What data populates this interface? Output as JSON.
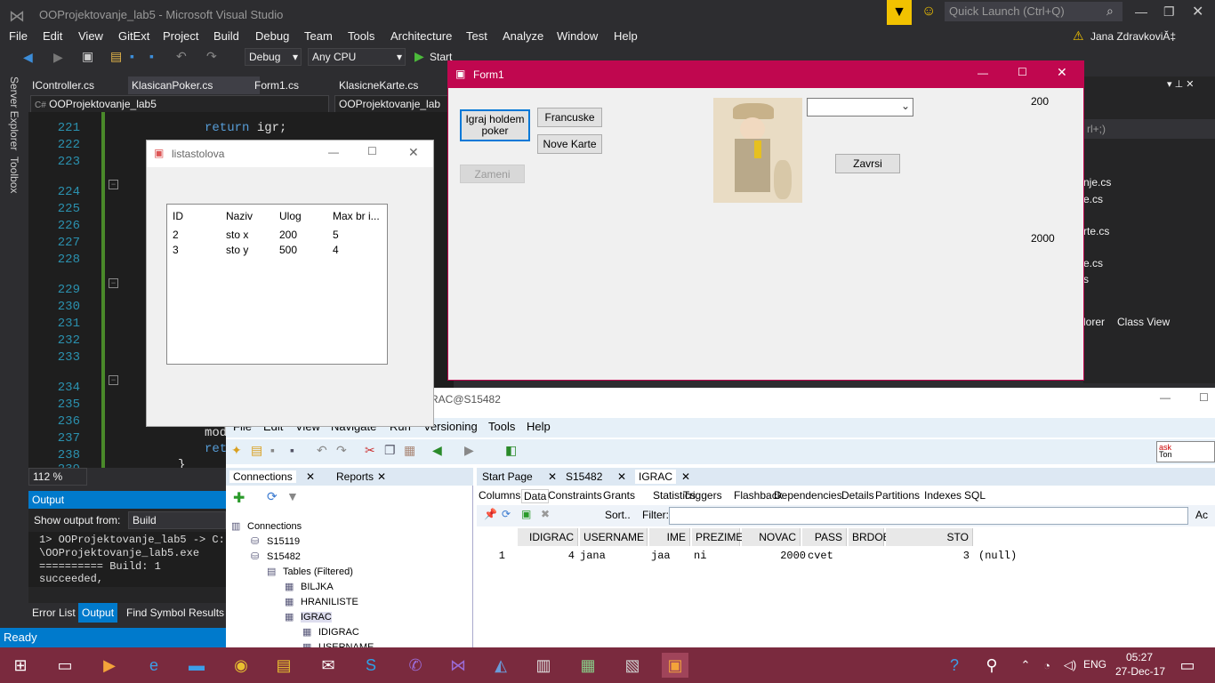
{
  "vs": {
    "title": "OOProjektovanje_lab5 - Microsoft Visual Studio",
    "quick_launch": "Quick Launch (Ctrl+Q)",
    "user": "Jana ZdravkoviĂ‡",
    "menu": [
      "File",
      "Edit",
      "View",
      "GitExt",
      "Project",
      "Build",
      "Debug",
      "Team",
      "Tools",
      "Architecture",
      "Test",
      "Analyze",
      "Window",
      "Help"
    ],
    "config": "Debug",
    "platform": "Any CPU",
    "start": "Start",
    "sidebar": [
      "Server Explorer",
      "Toolbox"
    ],
    "tabs": [
      "IController.cs",
      "KlasicanPoker.cs",
      "Form1.cs",
      "KlasicneKarte.cs"
    ],
    "project_dd": "OOProjektovanje_lab5",
    "member_dd": "OOProjektovanje_lab",
    "line_numbers": [
      "221",
      "222",
      "223",
      "224",
      "225",
      "226",
      "227",
      "228",
      "229",
      "230",
      "231",
      "232",
      "233",
      "234",
      "235",
      "236",
      "237",
      "238",
      "239"
    ],
    "code": {
      "l221_kw": "return",
      "l221": " igr;",
      "l222": "}",
      "l237": "mod",
      "l238": "ret",
      "l239": "}"
    },
    "zoom": "112 %",
    "output": {
      "title": "Output",
      "show_from": "Show output from:",
      "source": "Build",
      "lines": [
        "1>  OOProjektovanje_lab5 -> C:",
        "  \\OOProjektovanje_lab5.exe",
        "========== Build: 1 succeeded,"
      ]
    },
    "bottom_tabs": [
      "Error List",
      "Output",
      "Find Symbol Results"
    ],
    "status": "Ready",
    "right_panel": {
      "search": "rl+;)",
      "files": [
        "nje.cs",
        "e.cs",
        "rte.cs",
        "e.cs",
        "s"
      ],
      "tabs": [
        "lorer",
        "Class View"
      ]
    }
  },
  "listastolova": {
    "title": "listastolova",
    "headers": [
      "ID",
      "Naziv",
      "Ulog",
      "Max br i..."
    ],
    "rows": [
      [
        "2",
        "sto x",
        "200",
        "5"
      ],
      [
        "3",
        "sto y",
        "500",
        "4"
      ]
    ]
  },
  "form1": {
    "title": "Form1",
    "btn_igraj": "Igraj holdem poker",
    "btn_francuske": "Francuske",
    "btn_nove": "Nove Karte",
    "btn_zameni": "Zameni",
    "btn_zavrsi": "Zavrsi",
    "label_200": "200",
    "label_2000": "2000"
  },
  "sqldev": {
    "title": "RAC@S15482",
    "menu": [
      "File",
      "Edit",
      "View",
      "Navigate",
      "Run",
      "Versioning",
      "Tools",
      "Help"
    ],
    "conn_tabs": [
      "Connections",
      "Reports"
    ],
    "tree": [
      "Connections",
      "S15119",
      "S15482",
      "Tables (Filtered)",
      "BILJKA",
      "HRANILISTE",
      "IGRAC",
      "IDIGRAC",
      "USERNAME"
    ],
    "doc_tabs": [
      "Start Page",
      "S15482",
      "IGRAC"
    ],
    "sub_tabs": [
      "Columns",
      "Data",
      "Constraints",
      "Grants",
      "Statistics",
      "Triggers",
      "Flashback",
      "Dependencies",
      "Details",
      "Partitions",
      "Indexes",
      "SQL"
    ],
    "sort": "Sort..",
    "filter": "Filter:",
    "actions": "Ac",
    "columns": [
      "IDIGRAC",
      "USERNAME",
      "IME",
      "PREZIME",
      "NOVAC",
      "PASS",
      "BRDOBIJENIHPARTIJA",
      "STO"
    ],
    "row": [
      "1",
      "4",
      "jana",
      "jaa",
      "ni",
      "2000",
      "cvet",
      "3",
      "(null)"
    ],
    "small_popup": [
      "ask",
      "Ton"
    ]
  },
  "taskbar": {
    "time": "05:27",
    "date": "27-Dec-17",
    "lang": "ENG"
  }
}
